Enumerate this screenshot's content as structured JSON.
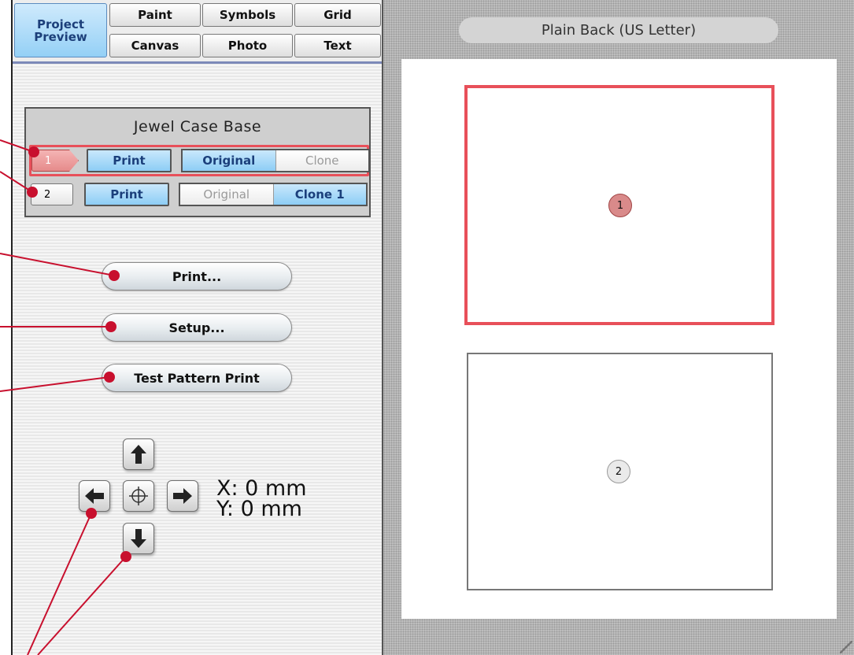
{
  "tabs": {
    "project_preview": "Project\nPreview",
    "paint": "Paint",
    "symbols": "Symbols",
    "grid": "Grid",
    "canvas": "Canvas",
    "photo": "Photo",
    "text": "Text"
  },
  "group": {
    "title": "Jewel Case Base",
    "rows": [
      {
        "number": "1",
        "print": "Print",
        "original": "Original",
        "clone": "Clone",
        "selected": true
      },
      {
        "number": "2",
        "print": "Print",
        "original": "Original",
        "clone": "Clone 1",
        "selected": false
      }
    ]
  },
  "buttons": {
    "print": "Print...",
    "setup": "Setup...",
    "test_pattern": "Test Pattern Print"
  },
  "position": {
    "x": "X: 0 mm",
    "y": "Y: 0 mm"
  },
  "preview": {
    "page_title": "Plain Back (US Letter)",
    "regions": [
      {
        "label": "1",
        "selected": true
      },
      {
        "label": "2",
        "selected": false
      }
    ]
  },
  "colors": {
    "accent_blue": "#94d0f6",
    "selection_red": "#e8505a",
    "callout_red": "#c8102e"
  },
  "icons": [
    "arrow-up-icon",
    "arrow-left-icon",
    "center-crosshair-icon",
    "arrow-right-icon",
    "arrow-down-icon",
    "resize-grip-icon"
  ]
}
